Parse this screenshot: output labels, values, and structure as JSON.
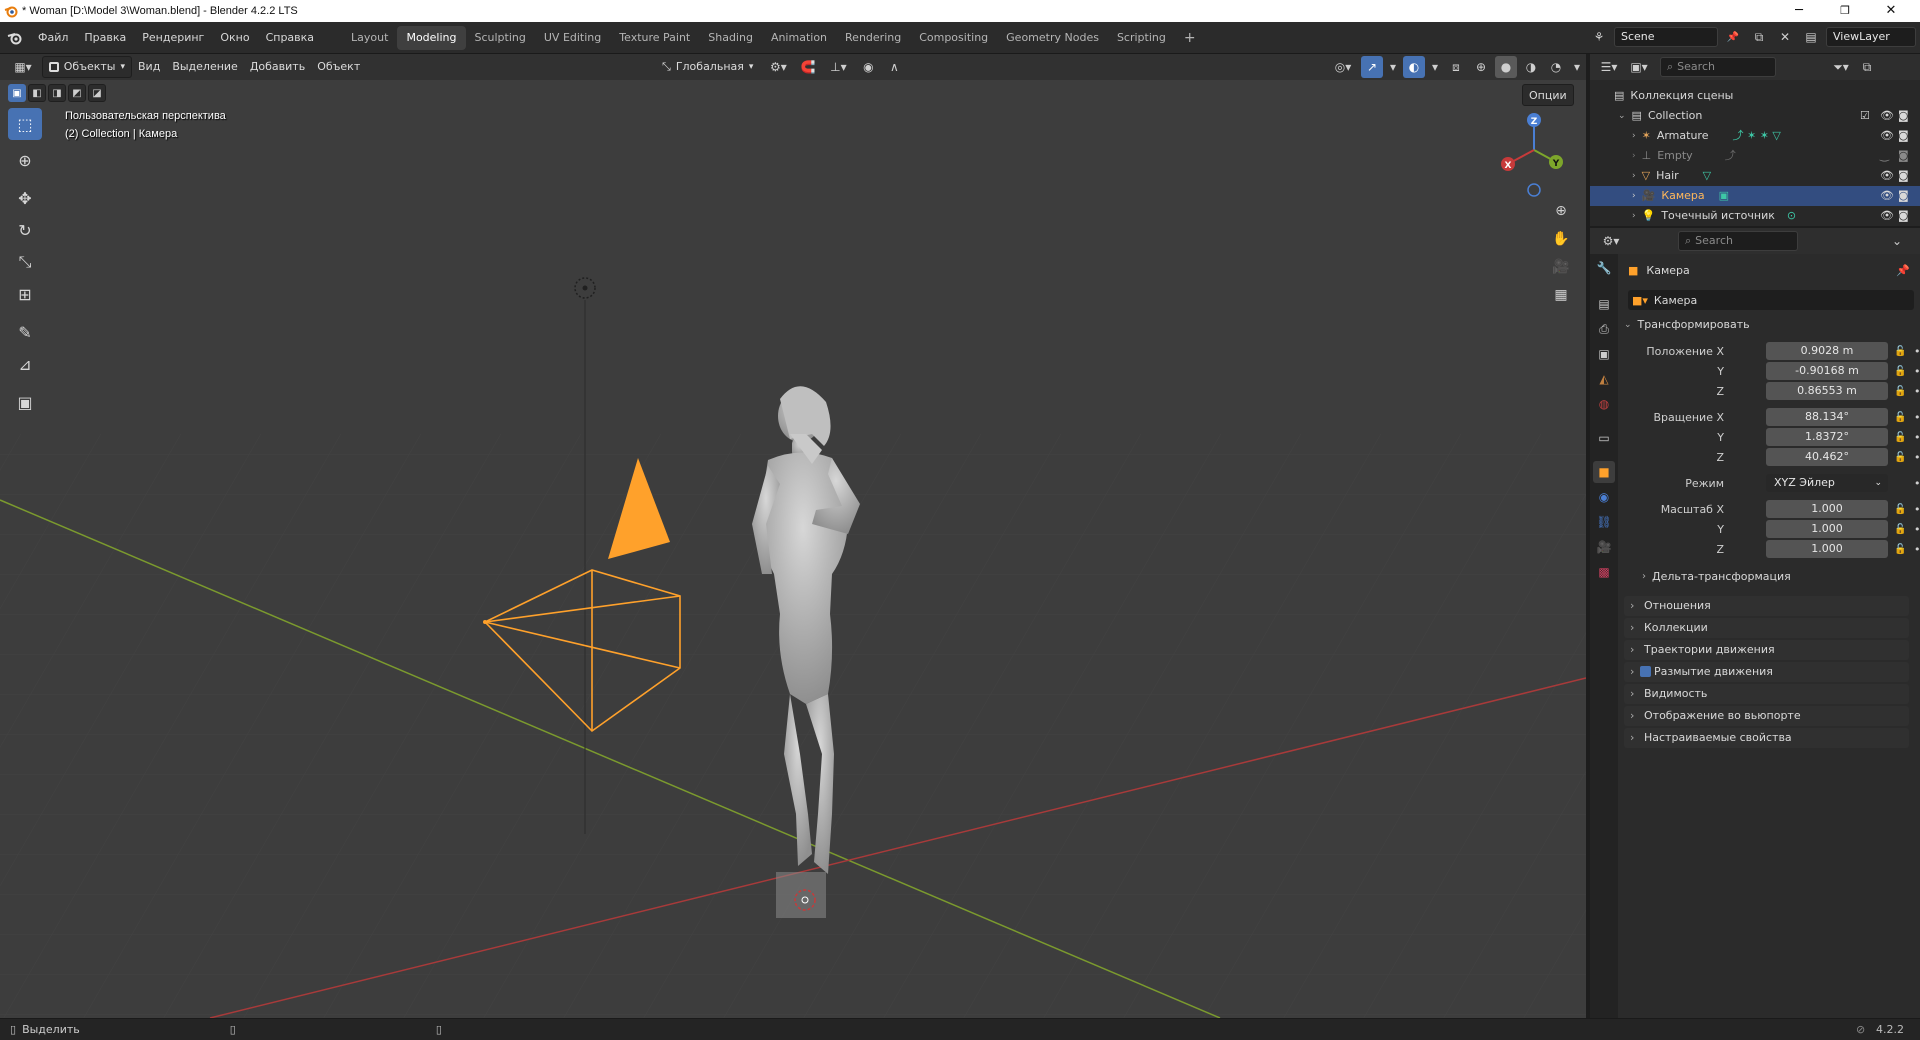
{
  "window": {
    "title": "* Woman [D:\\Model 3\\Woman.blend] - Blender 4.2.2 LTS",
    "minimize": "─",
    "maximize": "❐",
    "close": "✕"
  },
  "menus": [
    "Файл",
    "Правка",
    "Рендеринг",
    "Окно",
    "Справка"
  ],
  "workspaces": [
    {
      "label": "Layout",
      "active": false
    },
    {
      "label": "Modeling",
      "active": true
    },
    {
      "label": "Sculpting",
      "active": false
    },
    {
      "label": "UV Editing",
      "active": false
    },
    {
      "label": "Texture Paint",
      "active": false
    },
    {
      "label": "Shading",
      "active": false
    },
    {
      "label": "Animation",
      "active": false
    },
    {
      "label": "Rendering",
      "active": false
    },
    {
      "label": "Compositing",
      "active": false
    },
    {
      "label": "Geometry Nodes",
      "active": false
    },
    {
      "label": "Scripting",
      "active": false
    }
  ],
  "add_workspace": "+",
  "scene": {
    "label": "Scene",
    "view_layer": "ViewLayer"
  },
  "viewport_header": {
    "mode": "Объекты",
    "menus": [
      "Вид",
      "Выделение",
      "Добавить",
      "Объект"
    ],
    "orientation": "Глобальная",
    "options": "Опции"
  },
  "viewport": {
    "perspective": "Пользовательская перспектива",
    "context": "(2) Collection | Камера",
    "gizmo": {
      "x": "X",
      "y": "Y",
      "z": "Z"
    }
  },
  "tools": [
    {
      "name": "select-box-tool",
      "glyph": "⬚"
    },
    {
      "name": "cursor-tool",
      "glyph": "⊕"
    },
    {
      "name": "move-tool",
      "glyph": "✥"
    },
    {
      "name": "rotate-tool",
      "glyph": "↻"
    },
    {
      "name": "scale-tool",
      "glyph": "⤡"
    },
    {
      "name": "transform-tool",
      "glyph": "⊞"
    },
    {
      "name": "annotate-tool",
      "glyph": "✎"
    },
    {
      "name": "measure-tool",
      "glyph": "📐"
    },
    {
      "name": "add-cube-tool",
      "glyph": "▣"
    }
  ],
  "outliner": {
    "search_placeholder": "Search",
    "scene_collection": "Коллекция сцены",
    "collection": "Collection",
    "items": [
      {
        "label": "Armature",
        "icon": "armature-icon",
        "color": "#e4a55a",
        "selected": false,
        "dim": false
      },
      {
        "label": "Empty",
        "icon": "empty-icon",
        "color": "#8a8a8a",
        "selected": false,
        "dim": true
      },
      {
        "label": "Hair",
        "icon": "hair-icon",
        "color": "#e4a55a",
        "selected": false,
        "dim": false
      },
      {
        "label": "Камера",
        "icon": "camera-icon",
        "color": "#e4a55a",
        "selected": true,
        "dim": false
      },
      {
        "label": "Точечный источник",
        "icon": "light-icon",
        "color": "#e4a55a",
        "selected": false,
        "dim": false
      }
    ]
  },
  "properties": {
    "search_placeholder": "Search",
    "object_title": "Камера",
    "object_name": "Камера",
    "transform": {
      "title": "Трансформировать",
      "location_label": "Положение X",
      "location": [
        "0.9028 m",
        "-0.90168 m",
        "0.86553 m"
      ],
      "rotation_label": "Вращение X",
      "rotation": [
        "88.134°",
        "1.8372°",
        "40.462°"
      ],
      "mode_label": "Режим",
      "mode_value": "XYZ Эйлер",
      "scale_label": "Масштаб X",
      "scale": [
        "1.000",
        "1.000",
        "1.000"
      ],
      "y": "Y",
      "z": "Z",
      "delta": "Дельта-трансформация"
    },
    "panels": [
      "Отношения",
      "Коллекции",
      "Траектории движения",
      "Размытие движения",
      "Видимость",
      "Отображение во вьюпорте",
      "Настраиваемые свойства"
    ]
  },
  "statusbar": {
    "select": "Выделить",
    "version": "4.2.2"
  },
  "colors": {
    "accent": "#4772b3",
    "selected_object": "#ffa12b",
    "axis_x": "#c73a3a",
    "axis_y": "#7da62b"
  }
}
